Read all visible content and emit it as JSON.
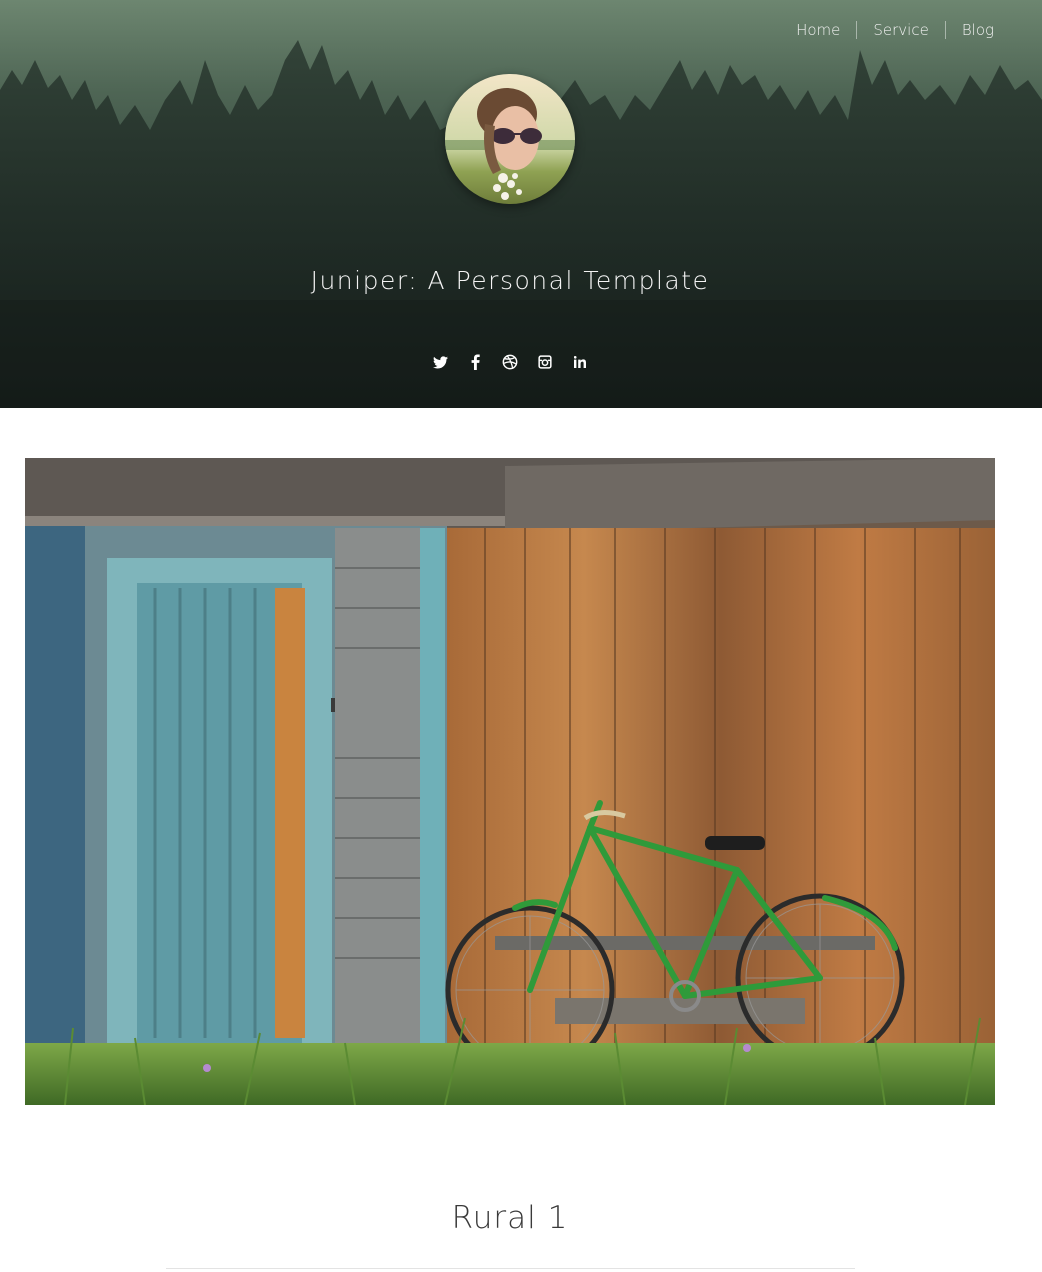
{
  "nav": {
    "items": [
      {
        "label": "Home"
      },
      {
        "label": "Service"
      },
      {
        "label": "Blog"
      }
    ]
  },
  "hero": {
    "title": "Juniper: A Personal Template",
    "social_icons": [
      "twitter-icon",
      "facebook-icon",
      "dribbble-icon",
      "instagram-icon",
      "linkedin-icon"
    ]
  },
  "post": {
    "title": "Rural 1"
  },
  "colors": {
    "hero_top": "#6d8670",
    "hero_bottom": "#1b2522",
    "bike_green": "#2f9a3a",
    "door_teal": "#6fb0b8",
    "wood_orange": "#b8733a"
  }
}
